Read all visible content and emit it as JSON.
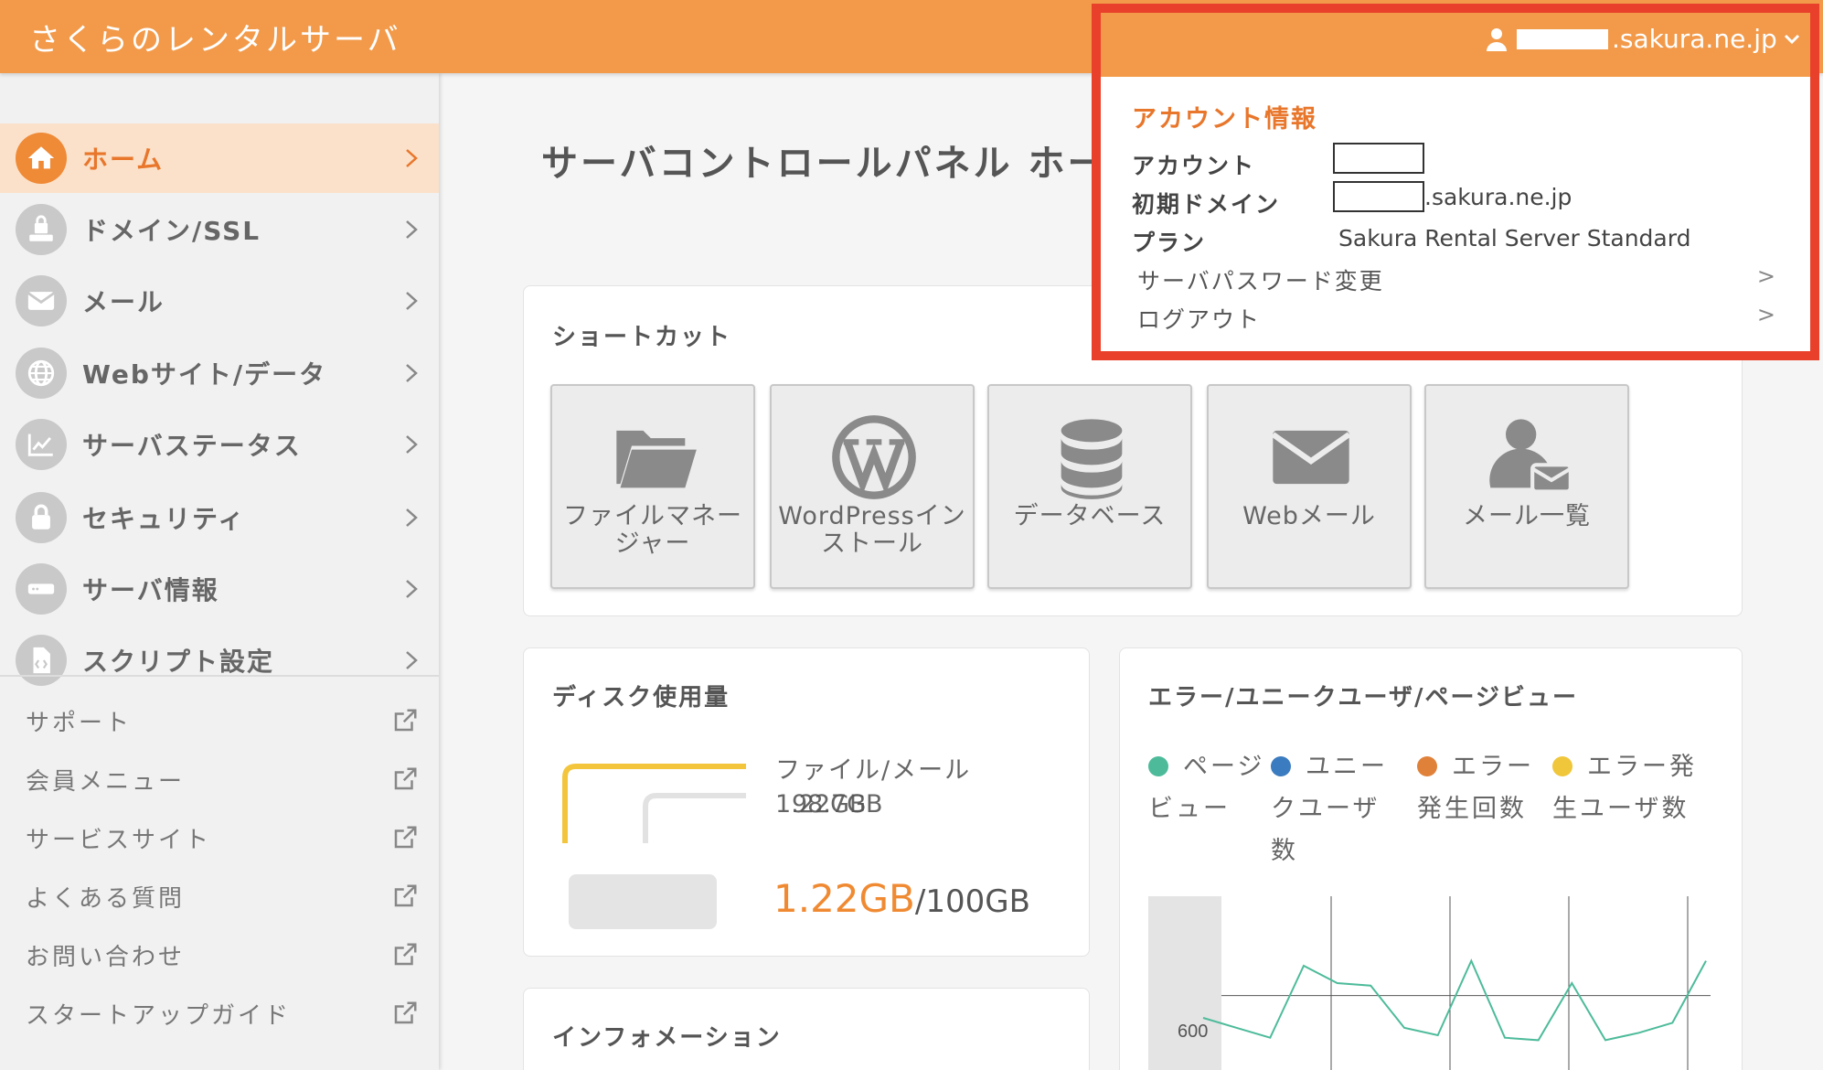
{
  "header": {
    "app_title": "さくらのレンタルサーバ",
    "account_suffix": ".sakura.ne.jp"
  },
  "sidebar": {
    "nav": [
      {
        "label": "ホーム",
        "icon": "home-icon",
        "active": true
      },
      {
        "label": "ドメイン/SSL",
        "icon": "domain-lock-icon"
      },
      {
        "label": "メール",
        "icon": "envelope-icon"
      },
      {
        "label": "Webサイト/データ",
        "icon": "globe-icon"
      },
      {
        "label": "サーバステータス",
        "icon": "chart-icon"
      },
      {
        "label": "セキュリティ",
        "icon": "lock-icon"
      },
      {
        "label": "サーバ情報",
        "icon": "server-icon"
      },
      {
        "label": "スクリプト設定",
        "icon": "script-file-icon"
      }
    ],
    "links": [
      {
        "label": "サポート"
      },
      {
        "label": "会員メニュー"
      },
      {
        "label": "サービスサイト"
      },
      {
        "label": "よくある質問"
      },
      {
        "label": "お問い合わせ"
      },
      {
        "label": "スタートアップガイド"
      }
    ]
  },
  "main": {
    "page_title": "サーバコントロールパネル ホーム",
    "shortcuts": {
      "title": "ショートカット",
      "items": [
        {
          "label": "ファイルマネージャー",
          "icon": "folder-icon"
        },
        {
          "label": "WordPressインストール",
          "icon": "wordpress-icon"
        },
        {
          "label": "データベース",
          "icon": "database-icon"
        },
        {
          "label": "Webメール",
          "icon": "envelope-icon"
        },
        {
          "label": "メール一覧",
          "icon": "user-mail-icon"
        }
      ]
    },
    "disk": {
      "title": "ディスク使用量",
      "legend_label": "ファイル/メール",
      "legend_overlap": "1.22GB",
      "legend_value": "98.7GB",
      "used": "1.22GB",
      "total": "/100GB"
    },
    "stats": {
      "title": "エラー/ユニークユーザ/ページビュー",
      "legend": [
        {
          "label": "ページビュー",
          "color": "#4dbb9a"
        },
        {
          "label": "ユニークユーザ数",
          "color": "#3b7bbf"
        },
        {
          "label": "エラー発生回数",
          "color": "#e0813a"
        },
        {
          "label": "エラー発生ユーザ数",
          "color": "#f0c63a"
        }
      ],
      "y_tick": "600"
    },
    "info": {
      "title": "インフォメーション"
    }
  },
  "account_menu": {
    "title": "アカウント情報",
    "account_label": "アカウント",
    "domain_label": "初期ドメイン",
    "domain_suffix": ".sakura.ne.jp",
    "plan_label": "プラン",
    "plan_value": "Sakura Rental Server Standard",
    "password_link": "サーバパスワード変更",
    "logout_link": "ログアウト",
    "arrow": ">"
  },
  "chart_data": {
    "type": "line",
    "title": "エラー/ユニークユーザ/ページビュー",
    "y_ticks": [
      "600"
    ],
    "series": [
      {
        "name": "ページビュー",
        "color": "#4dbb9a",
        "values": [
          510,
          470,
          430,
          720,
          650,
          640,
          470,
          440,
          740,
          430,
          420,
          650,
          420,
          450,
          490,
          740
        ]
      }
    ]
  }
}
